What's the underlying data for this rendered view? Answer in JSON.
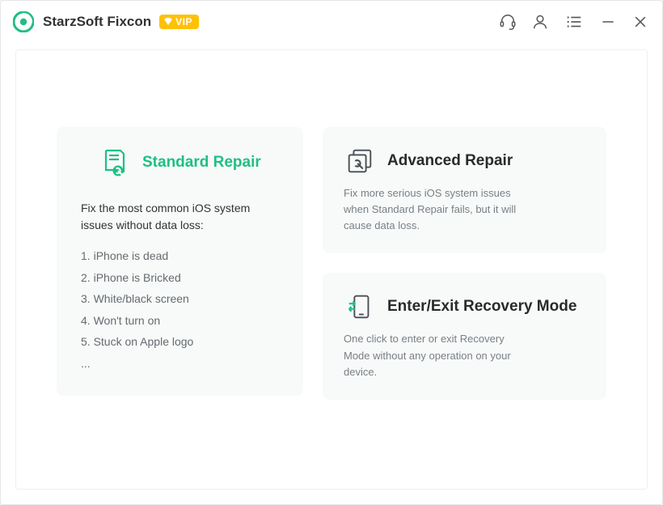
{
  "app": {
    "title": "StarzSoft Fixcon",
    "vip_label": "VIP"
  },
  "cards": {
    "standard": {
      "title": "Standard Repair",
      "desc": "Fix the most common iOS system issues without data loss:",
      "issues": [
        "iPhone is dead",
        "iPhone is Bricked",
        "White/black screen",
        "Won't turn on",
        "Stuck on Apple logo"
      ],
      "more": "..."
    },
    "advanced": {
      "title": "Advanced Repair",
      "desc": "Fix more serious iOS system issues when Standard Repair fails, but it will cause data loss."
    },
    "recovery": {
      "title": "Enter/Exit Recovery Mode",
      "desc": "One click to enter or exit Recovery Mode without any operation on your device."
    }
  }
}
